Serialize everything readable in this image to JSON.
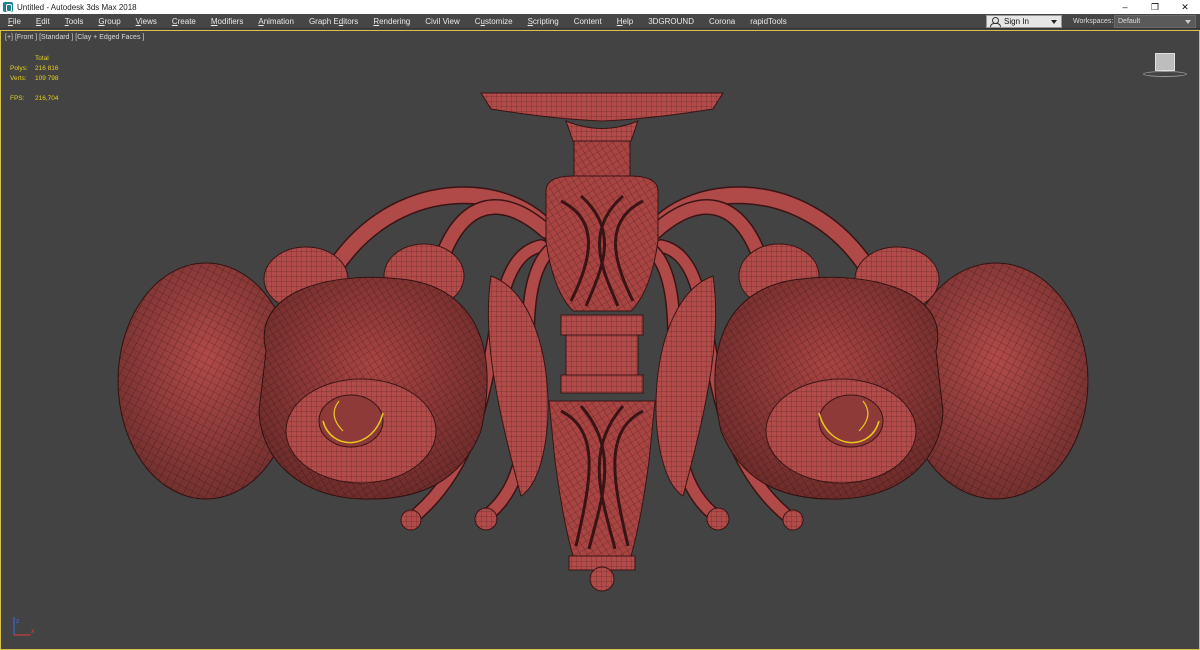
{
  "window": {
    "title": "Untitled - Autodesk 3ds Max 2018",
    "controls": {
      "minimize": "–",
      "maximize": "❐",
      "close": "✕"
    }
  },
  "menubar": {
    "items": [
      {
        "pre": "",
        "ul": "F",
        "post": "ile"
      },
      {
        "pre": "",
        "ul": "E",
        "post": "dit"
      },
      {
        "pre": "",
        "ul": "T",
        "post": "ools"
      },
      {
        "pre": "",
        "ul": "G",
        "post": "roup"
      },
      {
        "pre": "",
        "ul": "V",
        "post": "iews"
      },
      {
        "pre": "",
        "ul": "C",
        "post": "reate"
      },
      {
        "pre": "",
        "ul": "M",
        "post": "odifiers"
      },
      {
        "pre": "",
        "ul": "A",
        "post": "nimation"
      },
      {
        "pre": "Graph E",
        "ul": "d",
        "post": "itors"
      },
      {
        "pre": "",
        "ul": "R",
        "post": "endering"
      },
      {
        "pre": "Civil View",
        "ul": "",
        "post": ""
      },
      {
        "pre": "C",
        "ul": "u",
        "post": "stomize"
      },
      {
        "pre": "",
        "ul": "S",
        "post": "cripting"
      },
      {
        "pre": "Content",
        "ul": "",
        "post": ""
      },
      {
        "pre": "",
        "ul": "H",
        "post": "elp"
      },
      {
        "pre": "3DGROUND",
        "ul": "",
        "post": ""
      },
      {
        "pre": "Corona",
        "ul": "",
        "post": ""
      },
      {
        "pre": "rapidTools",
        "ul": "",
        "post": ""
      }
    ],
    "signin_label": "Sign In",
    "workspaces_label": "Workspaces:",
    "workspaces_value": "Default"
  },
  "viewport": {
    "label_segments": [
      "[+]",
      "[Front ]",
      "[Standard ]",
      "[Clay + Edged Faces ]"
    ],
    "stats": {
      "header": "Total",
      "polys_label": "Polys:",
      "polys_value": "216 816",
      "verts_label": "Verts:",
      "verts_value": "109 798",
      "fps_label": "FPS:",
      "fps_value": "216,704"
    },
    "model_color": "#b04a48",
    "wire_color": "#3a1414"
  }
}
